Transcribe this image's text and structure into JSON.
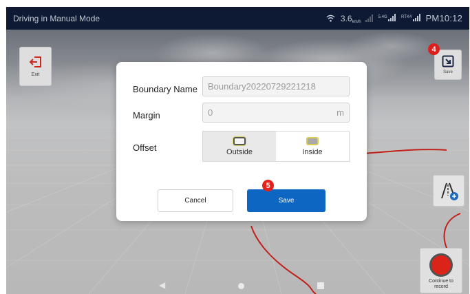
{
  "status_bar": {
    "title": "Driving in Manual Mode",
    "speed": "3.6",
    "speed_unit": "km/h",
    "signal_5g_label": "5.4G",
    "rtk_label": "RTK4",
    "time": "PM10:12"
  },
  "left_panel": {
    "exit_label": "Exit"
  },
  "right_panel": {
    "save_label": "Save",
    "record_label_line1": "Continue to",
    "record_label_line2": "record",
    "record_color": "#e4251b"
  },
  "markers": {
    "step4": "4",
    "step5": "5",
    "color": "#e5211d"
  },
  "dialog": {
    "name_label": "Boundary Name",
    "name_value": "Boundary20220729221218",
    "margin_label": "Margin",
    "margin_value": "0",
    "margin_unit": "m",
    "offset_label": "Offset",
    "offset_options": [
      "Outside",
      "Inside"
    ],
    "offset_selected": "Outside",
    "cancel_label": "Cancel",
    "save_label": "Save",
    "save_color": "#0d66c2"
  },
  "icons": {
    "exit": "exit-icon",
    "save": "save-icon",
    "add_line": "add-line-icon",
    "wifi": "wifi-icon",
    "back": "nav-back-icon",
    "home": "nav-home-icon",
    "recent": "nav-recent-icon"
  }
}
